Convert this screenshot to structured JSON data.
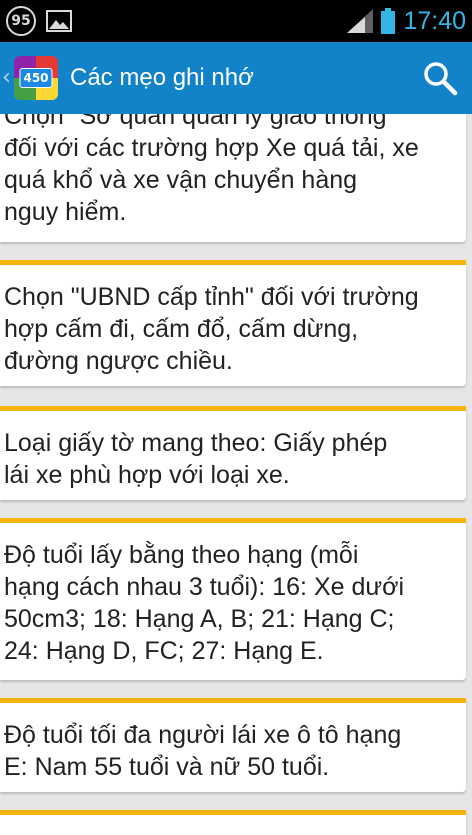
{
  "status_bar": {
    "notification_count": "95",
    "time": "17:40"
  },
  "app_bar": {
    "logo_text": "450",
    "title": "Các mẹo ghi nhớ"
  },
  "tips": [
    "Chọn \"Sở quản quản lý giao thông\"\nđối với các trường hợp Xe quá tải, xe\nquá khổ và xe vận chuyển hàng\nnguy hiểm.",
    "Chọn \"UBND cấp tỉnh\" đối với trường\nhợp cấm đi, cấm đổ, cấm dừng,\nđường ngược chiều.",
    "Loại giấy tờ mang theo: Giấy phép\nlái xe phù hợp với loại xe.",
    "Độ tuổi lấy bằng theo hạng (mỗi\nhạng cách nhau 3 tuổi): 16: Xe dưới\n50cm3; 18: Hạng A, B; 21: Hạng C;\n24: Hạng D, FC; 27: Hạng E.",
    "Độ tuổi tối đa người lái xe ô tô hạng\nE: Nam 55 tuổi và nữ 50 tuổi."
  ],
  "colors": {
    "app_bar": "#1283c9",
    "card_accent": "#f6b40e",
    "status_accent": "#33b5e5"
  }
}
